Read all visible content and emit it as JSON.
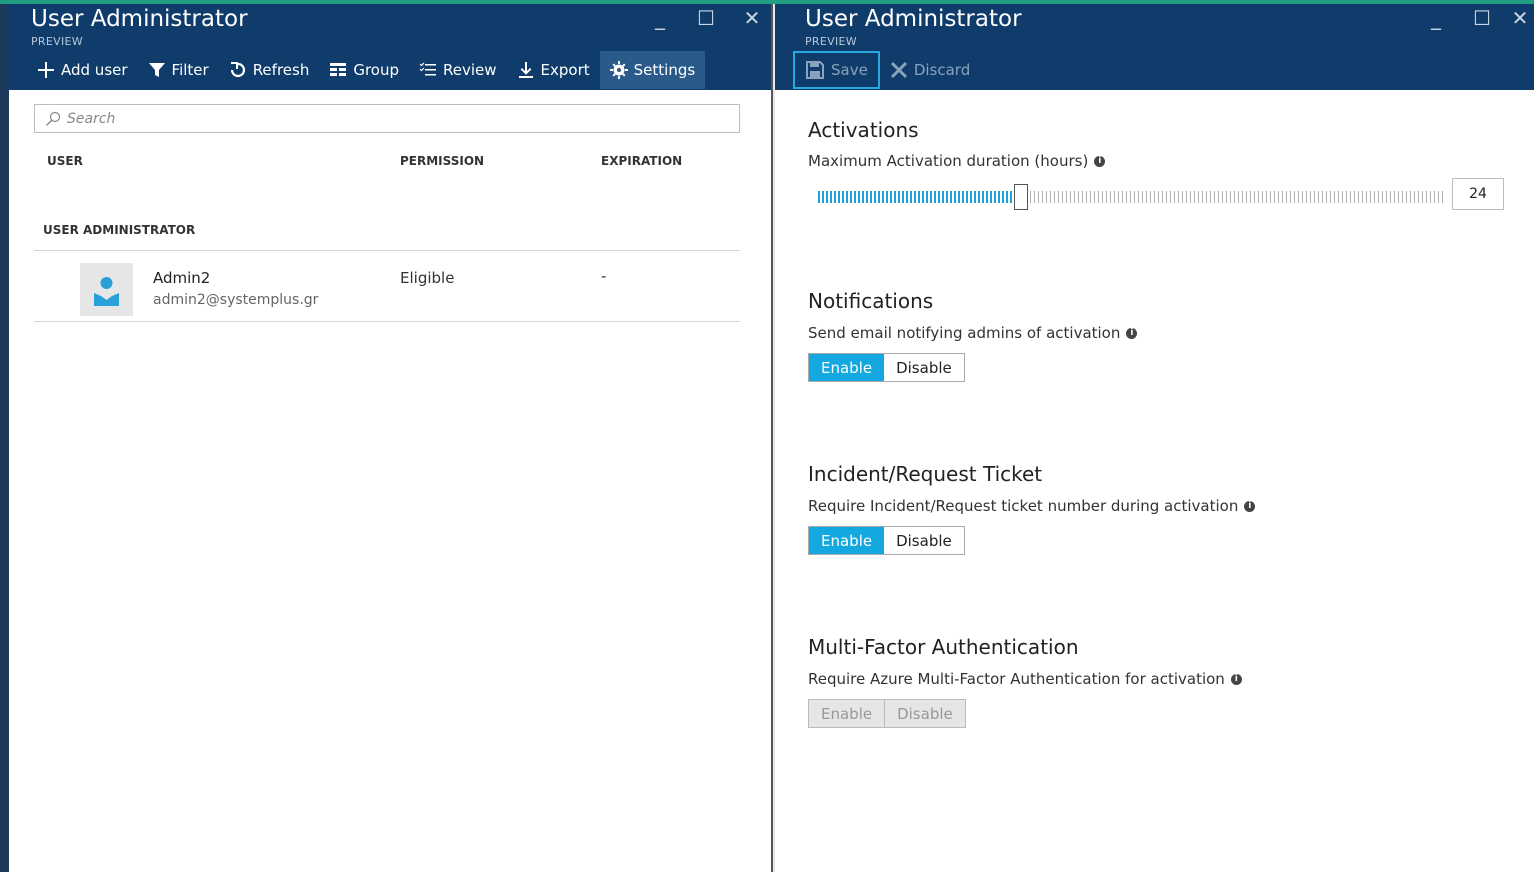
{
  "left": {
    "title": "User Administrator",
    "subtitle": "PREVIEW",
    "toolbar": [
      "Add user",
      "Filter",
      "Refresh",
      "Group",
      "Review",
      "Export",
      "Settings"
    ],
    "search_placeholder": "Search",
    "columns": [
      "USER",
      "PERMISSION",
      "EXPIRATION"
    ],
    "group_label": "USER ADMINISTRATOR",
    "rows": [
      {
        "name": "Admin2",
        "email": "admin2@systemplus.gr",
        "permission": "Eligible",
        "expiration": "-"
      }
    ]
  },
  "right": {
    "title": "User Administrator",
    "subtitle": "PREVIEW",
    "toolbar": {
      "save": "Save",
      "discard": "Discard"
    },
    "activations": {
      "title": "Activations",
      "desc": "Maximum Activation duration (hours)",
      "value": "24",
      "slider_fraction": 0.32
    },
    "notifications": {
      "title": "Notifications",
      "desc": "Send email notifying admins of activation",
      "enable": "Enable",
      "disable": "Disable"
    },
    "ticket": {
      "title": "Incident/Request Ticket",
      "desc": "Require Incident/Request ticket number during activation",
      "enable": "Enable",
      "disable": "Disable"
    },
    "mfa": {
      "title": "Multi-Factor Authentication",
      "desc": "Require Azure Multi-Factor Authentication for activation",
      "enable": "Enable",
      "disable": "Disable"
    }
  },
  "icons": [
    "add-icon",
    "filter-icon",
    "refresh-icon",
    "group-icon",
    "review-icon",
    "export-icon",
    "settings-gear-icon",
    "save-icon",
    "discard-icon",
    "search-icon",
    "info-icon",
    "user-avatar-icon"
  ],
  "colors": {
    "header": "#0f3c6a",
    "accent": "#13a8e0",
    "topline": "#1f9e84"
  }
}
